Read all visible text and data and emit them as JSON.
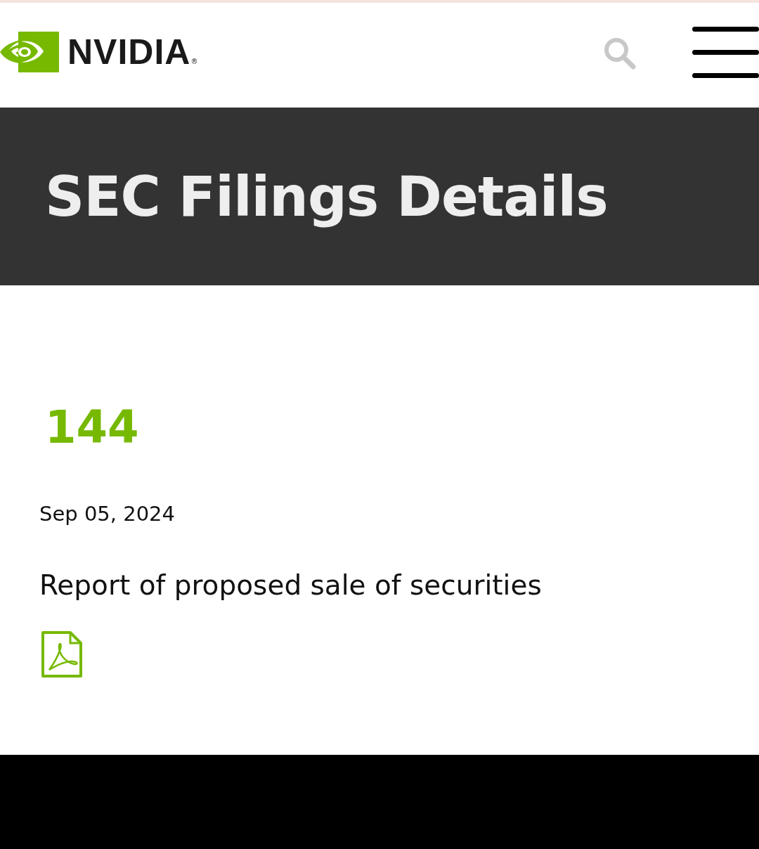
{
  "header": {
    "logo_text": "NVIDIA",
    "logo_mark": "®"
  },
  "banner": {
    "title": "SEC Filings Details"
  },
  "filing": {
    "form": "144",
    "date": "Sep 05, 2024",
    "description": "Report of proposed sale of securities"
  }
}
